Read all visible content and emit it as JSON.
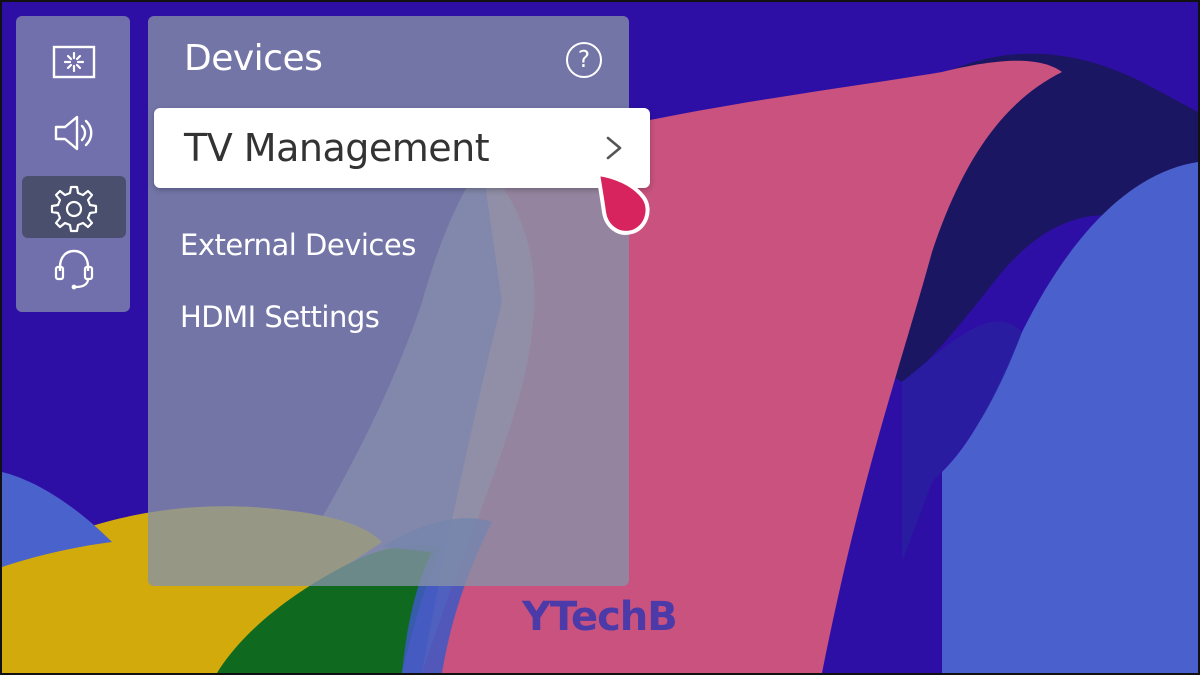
{
  "rail": {
    "items": [
      {
        "icon": "picture-settings-icon"
      },
      {
        "icon": "sound-icon"
      },
      {
        "icon": "gear-icon",
        "selected": true
      },
      {
        "icon": "support-headset-icon"
      }
    ]
  },
  "panel": {
    "title": "Devices",
    "help_glyph": "?",
    "selected_item": "TV Management",
    "items": [
      "External Devices",
      "HDMI Settings"
    ]
  },
  "watermark": "YTechB",
  "colors": {
    "background": "#2e0fa6",
    "pink": "#c9527e",
    "navy": "#1a1660",
    "cornflower": "#4a62cc",
    "yellow": "#d2aa0c",
    "green": "#0f6a20",
    "pointer": "#d7245f"
  }
}
